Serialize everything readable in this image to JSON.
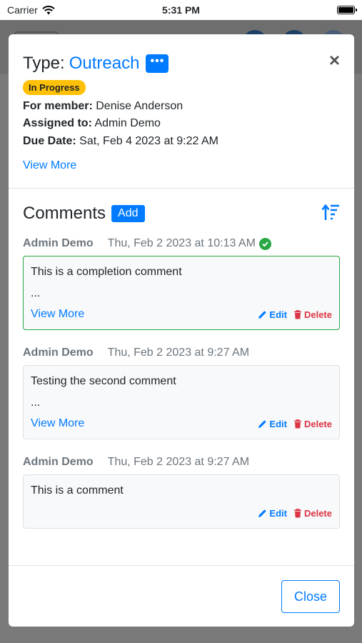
{
  "status_bar": {
    "carrier": "Carrier",
    "time": "5:31 PM"
  },
  "modal": {
    "type_label": "Type:",
    "type_value": "Outreach",
    "more_button": "•••",
    "close_icon": "×",
    "status_badge": "In Progress",
    "member_label": "For member:",
    "member_value": "Denise Anderson",
    "assigned_label": "Assigned to:",
    "assigned_value": "Admin Demo",
    "due_label": "Due Date:",
    "due_value": "Sat, Feb 4 2023 at 9:22 AM",
    "view_more": "View More"
  },
  "comments": {
    "title": "Comments",
    "add_label": "Add",
    "items": [
      {
        "author": "Admin Demo",
        "date": "Thu, Feb 2 2023 at 10:13 AM",
        "completed": true,
        "text": "This is a completion comment",
        "ellipsis": "...",
        "view_more": "View More",
        "edit": "Edit",
        "delete": "Delete"
      },
      {
        "author": "Admin Demo",
        "date": "Thu, Feb 2 2023 at 9:27 AM",
        "completed": false,
        "text": "Testing the second comment",
        "ellipsis": "...",
        "view_more": "View More",
        "edit": "Edit",
        "delete": "Delete"
      },
      {
        "author": "Admin Demo",
        "date": "Thu, Feb 2 2023 at 9:27 AM",
        "completed": false,
        "text": "This is a comment",
        "edit": "Edit",
        "delete": "Delete"
      }
    ]
  },
  "footer": {
    "close_label": "Close"
  },
  "colors": {
    "primary": "#007bff",
    "success": "#28a745",
    "danger": "#dc3545",
    "warning": "#ffc107"
  },
  "icons": [
    "wifi-icon",
    "battery-icon",
    "ellipsis-icon",
    "close-icon",
    "sort-icon",
    "check-circle-icon",
    "pencil-icon",
    "trash-icon"
  ]
}
